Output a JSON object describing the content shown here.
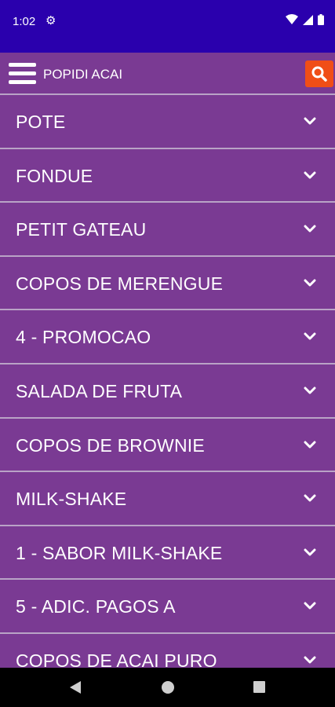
{
  "status_bar": {
    "time": "1:02"
  },
  "app_bar": {
    "title": "POPIDI ACAI"
  },
  "menu": {
    "items": [
      {
        "label": "POTE"
      },
      {
        "label": "FONDUE"
      },
      {
        "label": "PETIT GATEAU"
      },
      {
        "label": "COPOS DE MERENGUE"
      },
      {
        "label": "4 - PROMOCAO"
      },
      {
        "label": "SALADA DE FRUTA"
      },
      {
        "label": "COPOS DE BROWNIE"
      },
      {
        "label": "MILK-SHAKE"
      },
      {
        "label": "1 - SABOR MILK-SHAKE"
      },
      {
        "label": "5 - ADIC. PAGOS A"
      },
      {
        "label": "COPOS DE ACAI PURO"
      }
    ]
  },
  "colors": {
    "status_bar": "#2a00ad",
    "background": "#7a3a93",
    "divider": "#b9a3c6",
    "search_button": "#f04e17"
  }
}
